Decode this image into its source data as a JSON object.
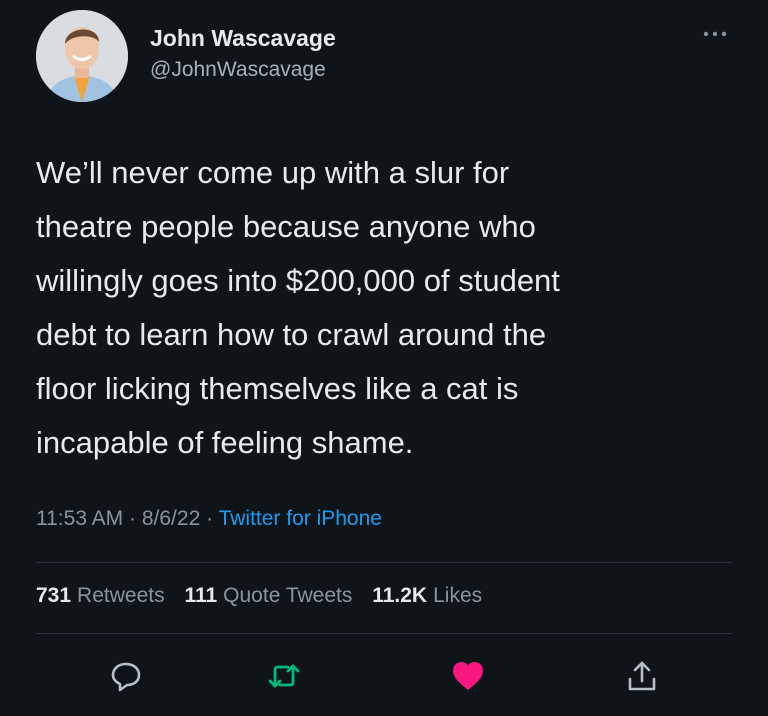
{
  "user": {
    "display_name": "John Wascavage",
    "handle": "@JohnWascavage",
    "avatar_icon": "profile-photo"
  },
  "tweet": {
    "text": "We’ll never come up with a slur for\ntheatre people because anyone who\nwillingly goes into $200,000 of student\ndebt to learn how to crawl around the\nfloor licking themselves like a cat is\nincapable of feeling shame.",
    "time": "11:53 AM",
    "date": "8/6/22",
    "separator": "·",
    "source": "Twitter for iPhone"
  },
  "stats": {
    "retweets_count": "731",
    "retweets_label": "Retweets",
    "quotes_count": "111",
    "quotes_label": "Quote Tweets",
    "likes_count": "11.2K",
    "likes_label": "Likes"
  },
  "actions": {
    "reply_icon": "reply-icon",
    "retweet_icon": "retweet-icon",
    "like_icon": "heart-icon",
    "share_icon": "share-icon",
    "liked": true
  },
  "colors": {
    "background": "#0f1419",
    "accent": "#1d9bf0",
    "retweet": "#00ba7c",
    "like": "#f91880",
    "secondary_text": "#8b949e"
  }
}
